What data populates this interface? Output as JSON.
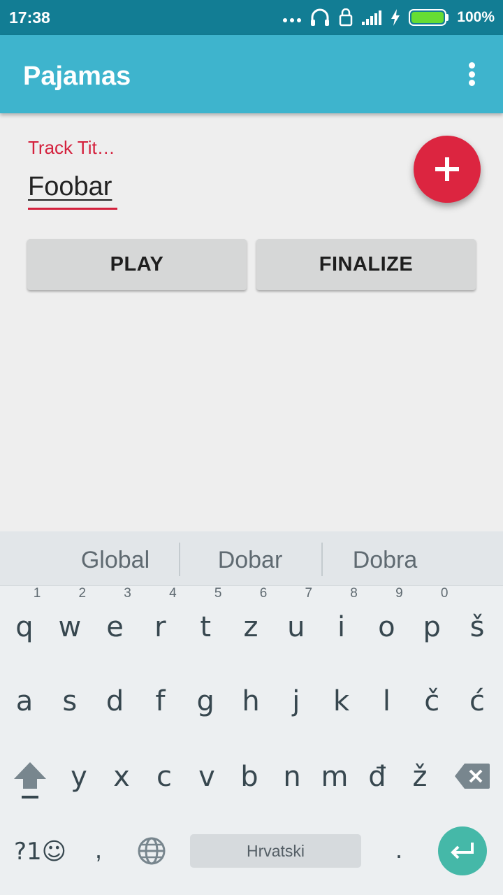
{
  "status_bar": {
    "time": "17:38",
    "battery_percent": "100%",
    "battery_level": 1.0,
    "icons": [
      "more-dots-icon",
      "headphones-icon",
      "lock-icon",
      "signal-icon",
      "charging-bolt-icon",
      "battery-icon"
    ]
  },
  "app_bar": {
    "title": "Pajamas",
    "menu_icon": "overflow-menu-icon"
  },
  "form": {
    "track_title_label": "Track Tit…",
    "track_title_value": "Foobar",
    "add_icon": "plus-icon"
  },
  "buttons": {
    "play": "PLAY",
    "finalize": "FINALIZE"
  },
  "keyboard": {
    "suggestions": [
      "Global",
      "Dobar",
      "Dobra"
    ],
    "row1": [
      "q",
      "w",
      "e",
      "r",
      "t",
      "z",
      "u",
      "i",
      "o",
      "p",
      "š"
    ],
    "row1_hints": [
      "1",
      "2",
      "3",
      "4",
      "5",
      "6",
      "7",
      "8",
      "9",
      "0",
      ""
    ],
    "row2": [
      "a",
      "s",
      "d",
      "f",
      "g",
      "h",
      "j",
      "k",
      "l",
      "č",
      "ć"
    ],
    "row3": [
      "y",
      "x",
      "c",
      "v",
      "b",
      "n",
      "m",
      "đ",
      "ž"
    ],
    "symbols_key": "?1☺",
    "comma": ",",
    "space_label": "Hrvatski",
    "period": ".",
    "accent_color": "#45b8a8"
  },
  "colors": {
    "status_bar": "#127d94",
    "app_bar": "#3eb4cd",
    "accent": "#dc2540"
  }
}
